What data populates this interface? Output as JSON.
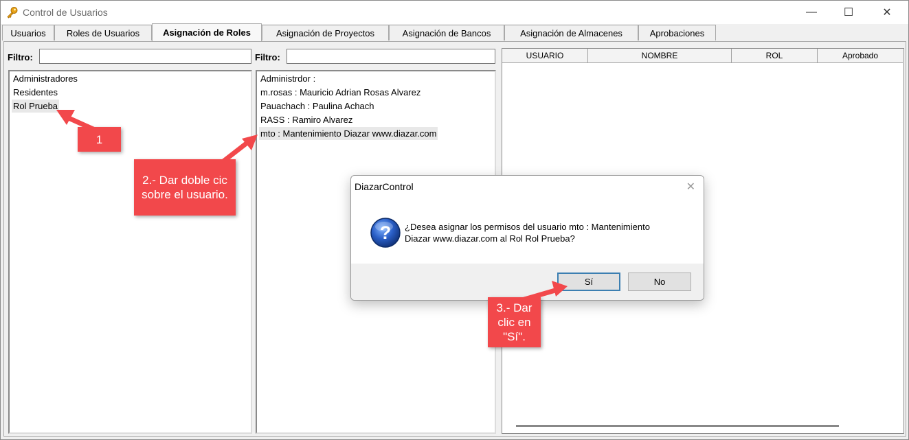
{
  "window": {
    "title": "Control de Usuarios",
    "min_glyph": "—",
    "max_glyph": "☐",
    "close_glyph": "✕",
    "icon": "key-icon"
  },
  "tabs": [
    {
      "label": "Usuarios",
      "active": false
    },
    {
      "label": "Roles de Usuarios",
      "active": false
    },
    {
      "label": "Asignación de Roles",
      "active": true
    },
    {
      "label": "Asignación de Proyectos",
      "active": false
    },
    {
      "label": "Asignación de Bancos",
      "active": false
    },
    {
      "label": "Asignación de Almacenes",
      "active": false
    },
    {
      "label": "Aprobaciones",
      "active": false
    }
  ],
  "roles_panel": {
    "filter_label": "Filtro:",
    "filter_value": "",
    "items": [
      "Administradores",
      "Residentes",
      "Rol Prueba"
    ],
    "selected": "Rol Prueba"
  },
  "users_panel": {
    "filter_label": "Filtro:",
    "filter_value": "",
    "items": [
      "Administrdor :",
      "m.rosas : Mauricio Adrian Rosas Alvarez",
      "Pauachach : Paulina Achach",
      "RASS : Ramiro Alvarez",
      "mto : Mantenimiento Diazar www.diazar.com"
    ],
    "selected": "mto : Mantenimiento Diazar www.diazar.com"
  },
  "grid": {
    "columns": [
      "USUARIO",
      "NOMBRE",
      "ROL",
      "Aprobado"
    ]
  },
  "dialog": {
    "title": "DiazarControl",
    "close_glyph": "✕",
    "question_glyph": "?",
    "message_line1": "¿Desea asignar los permisos del usuario mto : Mantenimiento",
    "message_line2": "Diazar www.diazar.com al Rol Rol Prueba?",
    "yes_label": "Sí",
    "no_label": "No"
  },
  "callouts": {
    "step1": "1",
    "step2_line1": "2.- Dar doble cic",
    "step2_line2": "sobre el usuario.",
    "step3_line1": "3.- Dar",
    "step3_line2": "clic en",
    "step3_line3": "\"Sí\"."
  },
  "colors": {
    "callout": "#f2484b",
    "selection": "#e8e8e8",
    "dialog_default_border": "#3c7fb1"
  }
}
